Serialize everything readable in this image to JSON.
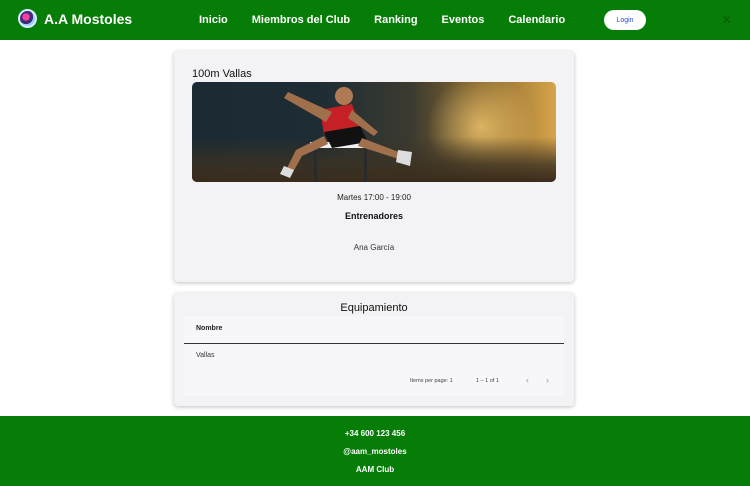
{
  "header": {
    "brand": "A.A Mostoles",
    "nav": [
      "Inicio",
      "Miembros del Club",
      "Ranking",
      "Eventos",
      "Calendario"
    ],
    "login_label": "Login",
    "close_icon": "close-icon"
  },
  "training": {
    "title": "100m Vallas",
    "image_icon": "hurdler-photo",
    "schedule": "Martes 17:00 - 19:00",
    "coaches_title": "Entrenadores",
    "coaches": [
      "Ana García"
    ]
  },
  "equipment": {
    "title": "Equipamiento",
    "column_header": "Nombre",
    "rows": [
      "Vallas"
    ],
    "items_per_page_label": "Items per page:",
    "items_per_page_value": "1",
    "range": "1 – 1 of 1"
  },
  "footer": {
    "phone": "+34 600 123 456",
    "handle": "@aam_mostoles",
    "club": "AAM Club"
  },
  "colors": {
    "primary_green": "#067d06",
    "card_bg": "#f3f3f5",
    "login_text": "#2a4fd6"
  }
}
